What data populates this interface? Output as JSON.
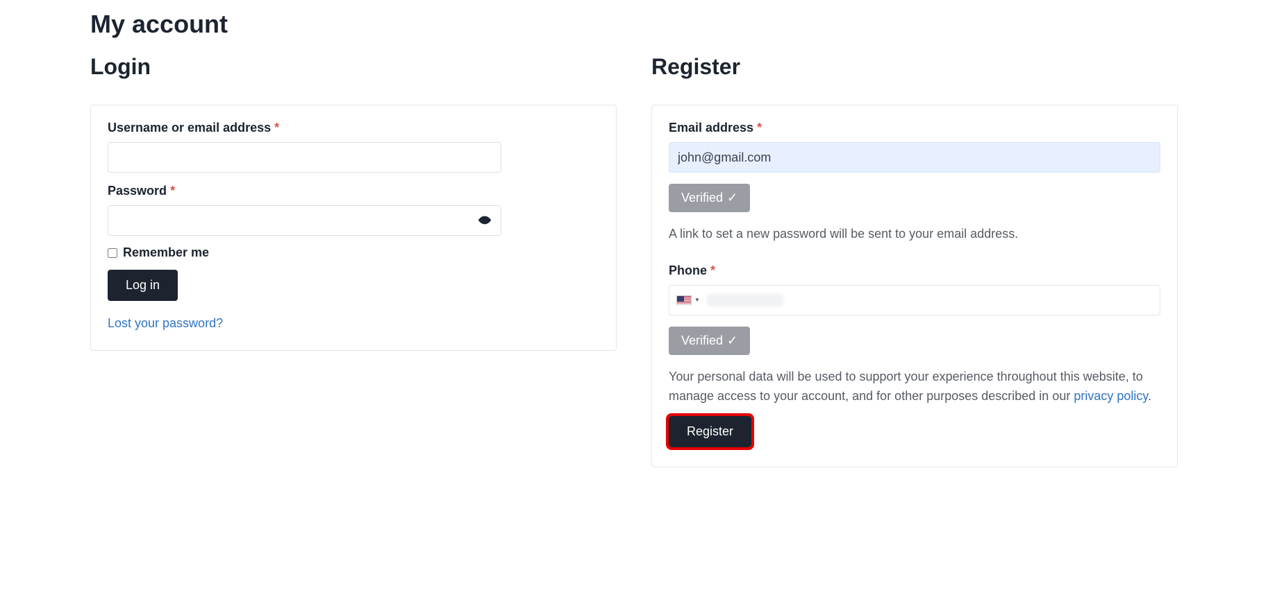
{
  "pageTitle": "My account",
  "login": {
    "heading": "Login",
    "usernameLabel": "Username or email address",
    "passwordLabel": "Password",
    "rememberLabel": "Remember me",
    "loginButton": "Log in",
    "lostPassword": "Lost your password?"
  },
  "register": {
    "heading": "Register",
    "emailLabel": "Email address",
    "emailValue": "john@gmail.com",
    "verifiedLabel": "Verified",
    "passwordInfo": "A link to set a new password will be sent to your email address.",
    "phoneLabel": "Phone",
    "privacyTextBefore": "Your personal data will be used to support your experience throughout this website, to manage access to your account, and for other purposes described in our ",
    "privacyLinkText": "privacy policy",
    "privacyTextAfter": ".",
    "registerButton": "Register"
  },
  "requiredMark": "*",
  "checkMark": "✓"
}
